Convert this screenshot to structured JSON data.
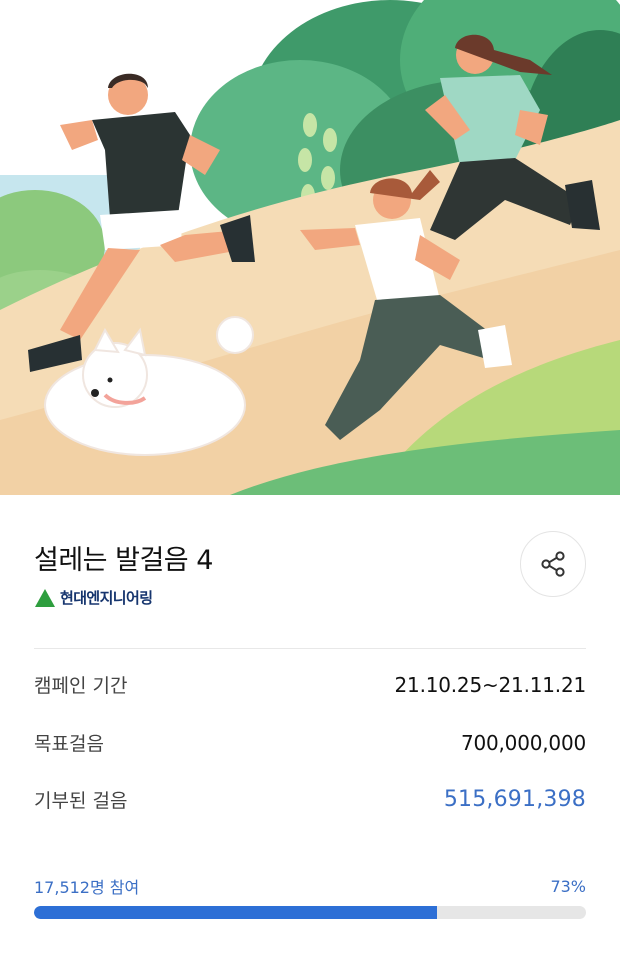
{
  "hero": {
    "illustration": "runners-with-dog-illustration"
  },
  "campaign": {
    "title": "설레는 발걸음 4",
    "sponsor": "현대엔지니어링",
    "sponsor_icon": "green-triangle-logo"
  },
  "actions": {
    "share_icon": "share-icon"
  },
  "details": {
    "period_label": "캠페인 기간",
    "period_value": "21.10.25~21.11.21",
    "goal_label": "목표걸음",
    "goal_value": "700,000,000",
    "donated_label": "기부된 걸음",
    "donated_value": "515,691,398"
  },
  "progress": {
    "participants": "17,512명 참여",
    "percent_label": "73%",
    "percent": 73
  },
  "colors": {
    "accent": "#3b6fc5",
    "progress_fill": "#2d6fd6",
    "brand_green": "#2e9e3e",
    "brand_navy": "#16356e"
  }
}
